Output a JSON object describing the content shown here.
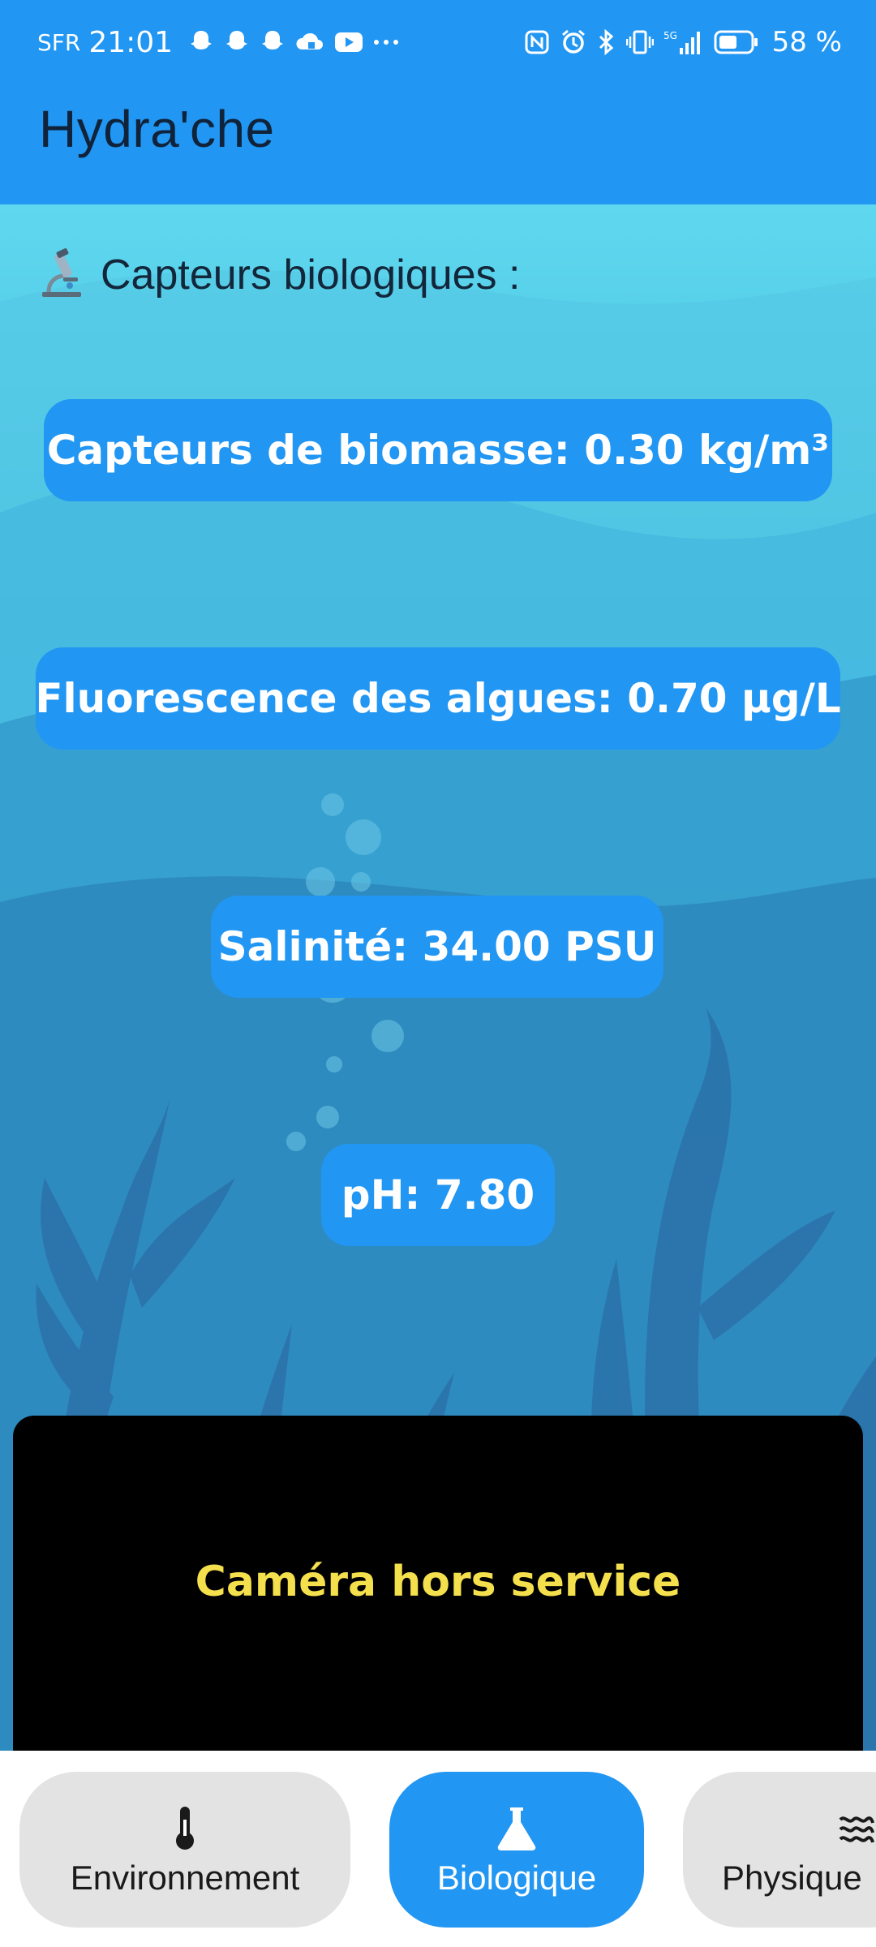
{
  "status_bar": {
    "carrier": "SFR",
    "time": "21:01",
    "notification_icons": [
      "snapchat-icon",
      "snapchat-icon",
      "snapchat-icon",
      "cloud-icon",
      "youtube-icon",
      "more-icon"
    ],
    "system_icons": [
      "nfc-icon",
      "alarm-icon",
      "bluetooth-icon",
      "vibrate-icon",
      "signal-icon",
      "battery-icon"
    ],
    "network": "5G",
    "battery": "58 %",
    "battery_level": 0.58
  },
  "app_bar": {
    "title": "Hydra'che"
  },
  "section": {
    "icon": "microscope-icon",
    "title": "Capteurs biologiques :"
  },
  "sensors": [
    {
      "label": "Capteurs de biomasse: 0.30 kg/m³"
    },
    {
      "label": "Fluorescence des algues: 0.70 µg/L"
    },
    {
      "label": "Salinité: 34.00 PSU"
    },
    {
      "label": "pH: 7.80"
    }
  ],
  "camera": {
    "status": "Caméra hors service"
  },
  "bottom_nav": {
    "items": [
      {
        "label": "Environnement",
        "icon": "thermometer-icon",
        "active": false
      },
      {
        "label": "Biologique",
        "icon": "flask-icon",
        "active": true
      },
      {
        "label": "Physique",
        "icon": "waves-icon",
        "active": false
      }
    ]
  },
  "colors": {
    "primary": "#2196f3",
    "camera_text": "#f4e04d",
    "water_top": "#5fd8ef",
    "water_bottom": "#2a6e9e"
  }
}
